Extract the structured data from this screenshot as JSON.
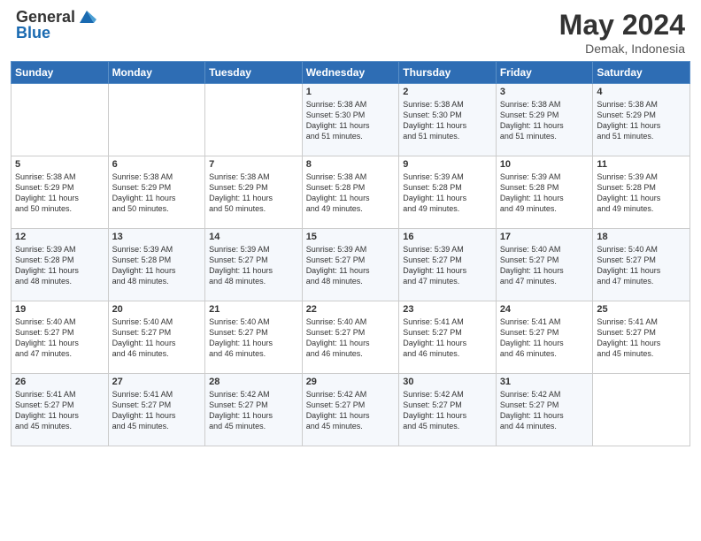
{
  "logo": {
    "general": "General",
    "blue": "Blue"
  },
  "title": {
    "month": "May 2024",
    "location": "Demak, Indonesia"
  },
  "headers": [
    "Sunday",
    "Monday",
    "Tuesday",
    "Wednesday",
    "Thursday",
    "Friday",
    "Saturday"
  ],
  "weeks": [
    [
      {
        "day": "",
        "info": ""
      },
      {
        "day": "",
        "info": ""
      },
      {
        "day": "",
        "info": ""
      },
      {
        "day": "1",
        "info": "Sunrise: 5:38 AM\nSunset: 5:30 PM\nDaylight: 11 hours\nand 51 minutes."
      },
      {
        "day": "2",
        "info": "Sunrise: 5:38 AM\nSunset: 5:30 PM\nDaylight: 11 hours\nand 51 minutes."
      },
      {
        "day": "3",
        "info": "Sunrise: 5:38 AM\nSunset: 5:29 PM\nDaylight: 11 hours\nand 51 minutes."
      },
      {
        "day": "4",
        "info": "Sunrise: 5:38 AM\nSunset: 5:29 PM\nDaylight: 11 hours\nand 51 minutes."
      }
    ],
    [
      {
        "day": "5",
        "info": "Sunrise: 5:38 AM\nSunset: 5:29 PM\nDaylight: 11 hours\nand 50 minutes."
      },
      {
        "day": "6",
        "info": "Sunrise: 5:38 AM\nSunset: 5:29 PM\nDaylight: 11 hours\nand 50 minutes."
      },
      {
        "day": "7",
        "info": "Sunrise: 5:38 AM\nSunset: 5:29 PM\nDaylight: 11 hours\nand 50 minutes."
      },
      {
        "day": "8",
        "info": "Sunrise: 5:38 AM\nSunset: 5:28 PM\nDaylight: 11 hours\nand 49 minutes."
      },
      {
        "day": "9",
        "info": "Sunrise: 5:39 AM\nSunset: 5:28 PM\nDaylight: 11 hours\nand 49 minutes."
      },
      {
        "day": "10",
        "info": "Sunrise: 5:39 AM\nSunset: 5:28 PM\nDaylight: 11 hours\nand 49 minutes."
      },
      {
        "day": "11",
        "info": "Sunrise: 5:39 AM\nSunset: 5:28 PM\nDaylight: 11 hours\nand 49 minutes."
      }
    ],
    [
      {
        "day": "12",
        "info": "Sunrise: 5:39 AM\nSunset: 5:28 PM\nDaylight: 11 hours\nand 48 minutes."
      },
      {
        "day": "13",
        "info": "Sunrise: 5:39 AM\nSunset: 5:28 PM\nDaylight: 11 hours\nand 48 minutes."
      },
      {
        "day": "14",
        "info": "Sunrise: 5:39 AM\nSunset: 5:27 PM\nDaylight: 11 hours\nand 48 minutes."
      },
      {
        "day": "15",
        "info": "Sunrise: 5:39 AM\nSunset: 5:27 PM\nDaylight: 11 hours\nand 48 minutes."
      },
      {
        "day": "16",
        "info": "Sunrise: 5:39 AM\nSunset: 5:27 PM\nDaylight: 11 hours\nand 47 minutes."
      },
      {
        "day": "17",
        "info": "Sunrise: 5:40 AM\nSunset: 5:27 PM\nDaylight: 11 hours\nand 47 minutes."
      },
      {
        "day": "18",
        "info": "Sunrise: 5:40 AM\nSunset: 5:27 PM\nDaylight: 11 hours\nand 47 minutes."
      }
    ],
    [
      {
        "day": "19",
        "info": "Sunrise: 5:40 AM\nSunset: 5:27 PM\nDaylight: 11 hours\nand 47 minutes."
      },
      {
        "day": "20",
        "info": "Sunrise: 5:40 AM\nSunset: 5:27 PM\nDaylight: 11 hours\nand 46 minutes."
      },
      {
        "day": "21",
        "info": "Sunrise: 5:40 AM\nSunset: 5:27 PM\nDaylight: 11 hours\nand 46 minutes."
      },
      {
        "day": "22",
        "info": "Sunrise: 5:40 AM\nSunset: 5:27 PM\nDaylight: 11 hours\nand 46 minutes."
      },
      {
        "day": "23",
        "info": "Sunrise: 5:41 AM\nSunset: 5:27 PM\nDaylight: 11 hours\nand 46 minutes."
      },
      {
        "day": "24",
        "info": "Sunrise: 5:41 AM\nSunset: 5:27 PM\nDaylight: 11 hours\nand 46 minutes."
      },
      {
        "day": "25",
        "info": "Sunrise: 5:41 AM\nSunset: 5:27 PM\nDaylight: 11 hours\nand 45 minutes."
      }
    ],
    [
      {
        "day": "26",
        "info": "Sunrise: 5:41 AM\nSunset: 5:27 PM\nDaylight: 11 hours\nand 45 minutes."
      },
      {
        "day": "27",
        "info": "Sunrise: 5:41 AM\nSunset: 5:27 PM\nDaylight: 11 hours\nand 45 minutes."
      },
      {
        "day": "28",
        "info": "Sunrise: 5:42 AM\nSunset: 5:27 PM\nDaylight: 11 hours\nand 45 minutes."
      },
      {
        "day": "29",
        "info": "Sunrise: 5:42 AM\nSunset: 5:27 PM\nDaylight: 11 hours\nand 45 minutes."
      },
      {
        "day": "30",
        "info": "Sunrise: 5:42 AM\nSunset: 5:27 PM\nDaylight: 11 hours\nand 45 minutes."
      },
      {
        "day": "31",
        "info": "Sunrise: 5:42 AM\nSunset: 5:27 PM\nDaylight: 11 hours\nand 44 minutes."
      },
      {
        "day": "",
        "info": ""
      }
    ]
  ]
}
